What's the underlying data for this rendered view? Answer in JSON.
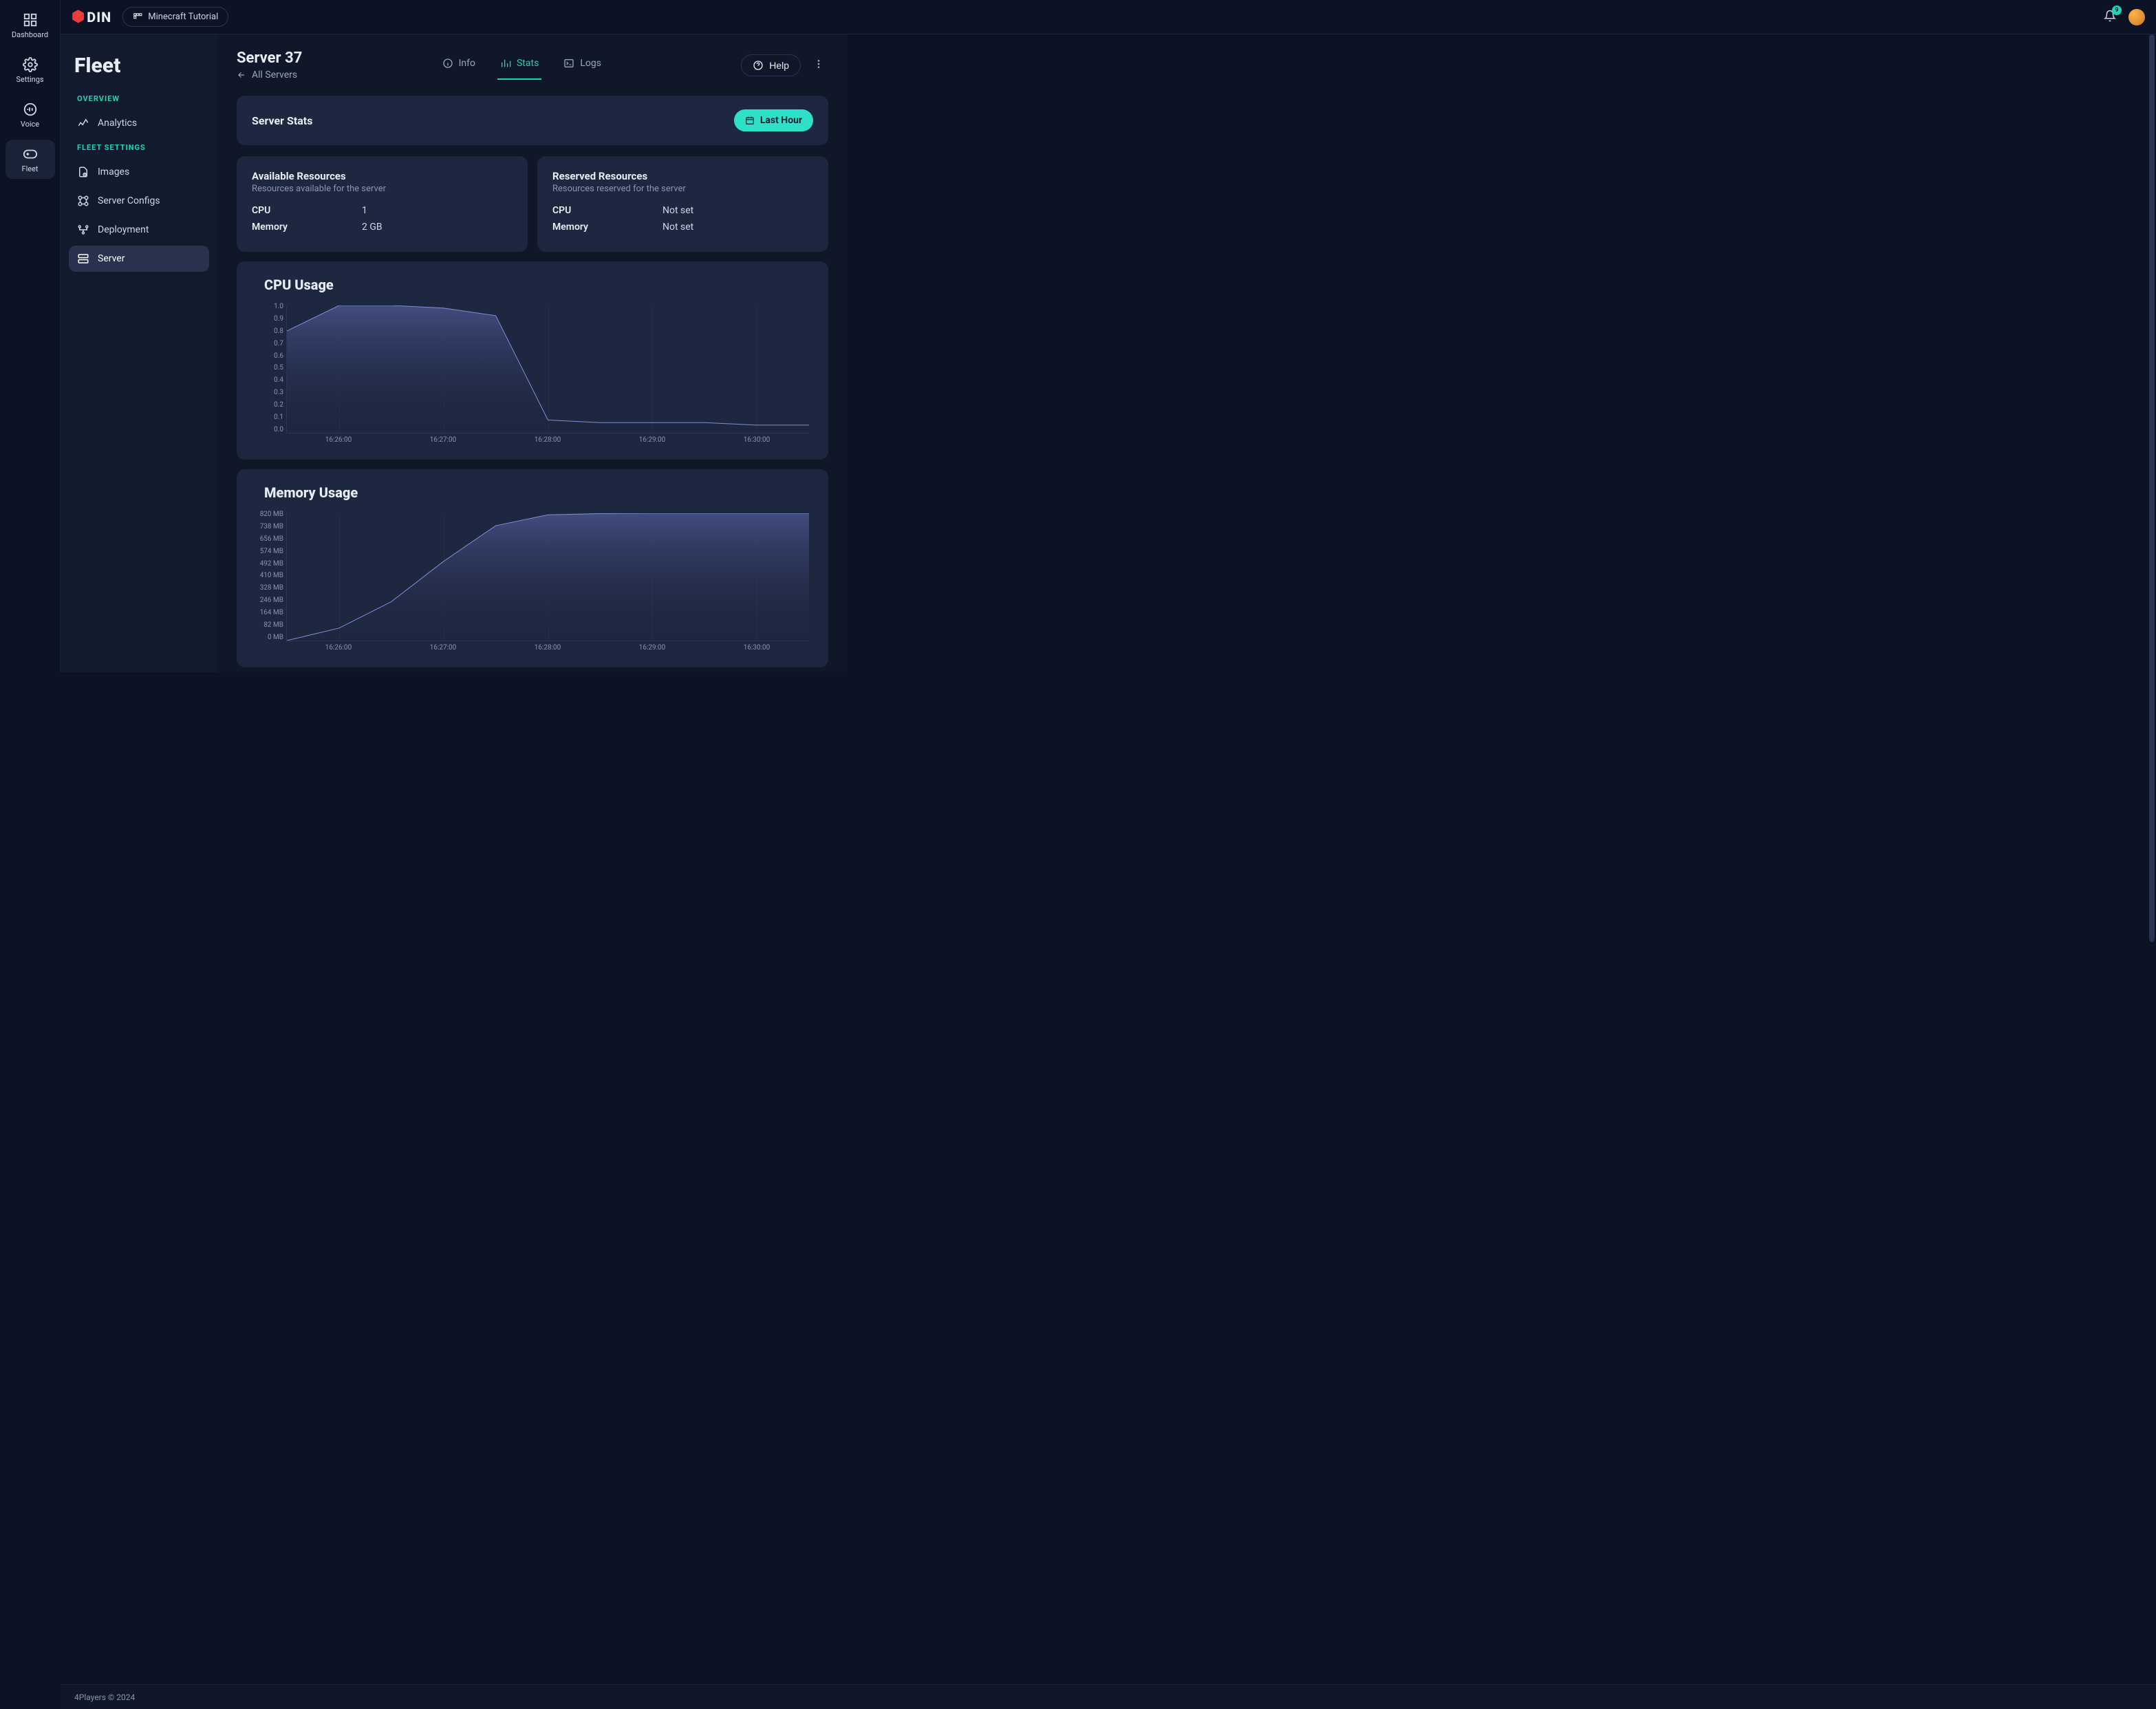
{
  "brand": {
    "name": "DIN"
  },
  "project_pill": "Minecraft Tutorial",
  "notifications_count": "9",
  "rail": [
    {
      "label": "Dashboard",
      "icon": "dashboard"
    },
    {
      "label": "Settings",
      "icon": "settings"
    },
    {
      "label": "Voice",
      "icon": "voice"
    },
    {
      "label": "Fleet",
      "icon": "fleet",
      "active": true
    }
  ],
  "sidebar": {
    "title": "Fleet",
    "sections": [
      {
        "label": "OVERVIEW",
        "items": [
          {
            "label": "Analytics",
            "icon": "analytics"
          }
        ]
      },
      {
        "label": "FLEET SETTINGS",
        "items": [
          {
            "label": "Images",
            "icon": "images"
          },
          {
            "label": "Server Configs",
            "icon": "configs"
          },
          {
            "label": "Deployment",
            "icon": "deployment"
          },
          {
            "label": "Server",
            "icon": "server",
            "active": true
          }
        ]
      }
    ]
  },
  "page": {
    "title": "Server 37",
    "back_label": "All Servers",
    "tabs": [
      {
        "label": "Info",
        "icon": "info"
      },
      {
        "label": "Stats",
        "icon": "stats",
        "active": true
      },
      {
        "label": "Logs",
        "icon": "logs"
      }
    ],
    "help_label": "Help"
  },
  "stats_panel": {
    "title": "Server Stats",
    "time_range_label": "Last Hour"
  },
  "resources": {
    "available": {
      "title": "Available Resources",
      "subtitle": "Resources available for the server",
      "cpu_label": "CPU",
      "cpu_value": "1",
      "mem_label": "Memory",
      "mem_value": "2 GB"
    },
    "reserved": {
      "title": "Reserved Resources",
      "subtitle": "Resources reserved for the server",
      "cpu_label": "CPU",
      "cpu_value": "Not set",
      "mem_label": "Memory",
      "mem_value": "Not set"
    }
  },
  "footer": "4Players © 2024",
  "chart_data": [
    {
      "type": "area",
      "title": "CPU Usage",
      "ylim": [
        0,
        1
      ],
      "y_ticks": [
        "1.0",
        "0.9",
        "0.8",
        "0.7",
        "0.6",
        "0.5",
        "0.4",
        "0.3",
        "0.2",
        "0.1",
        "0.0"
      ],
      "x_ticks": [
        "16:26:00",
        "16:27:00",
        "16:28:00",
        "16:29:00",
        "16:30:00"
      ],
      "x": [
        "16:25:30",
        "16:26:00",
        "16:26:30",
        "16:27:00",
        "16:27:30",
        "16:28:00",
        "16:28:30",
        "16:29:00",
        "16:29:30",
        "16:30:00",
        "16:30:30"
      ],
      "values": [
        0.8,
        1.0,
        1.0,
        0.98,
        0.92,
        0.1,
        0.08,
        0.08,
        0.08,
        0.06,
        0.06
      ],
      "stroke": "#7f8fd6",
      "fill_from": "#4a568fcc",
      "fill_to": "#1e274000"
    },
    {
      "type": "area",
      "title": "Memory Usage",
      "ylim": [
        0,
        820
      ],
      "y_ticks": [
        "820 MB",
        "738 MB",
        "656 MB",
        "574 MB",
        "492 MB",
        "410 MB",
        "328 MB",
        "246 MB",
        "164 MB",
        "82 MB",
        "0 MB"
      ],
      "x_ticks": [
        "16:26:00",
        "16:27:00",
        "16:28:00",
        "16:29:00",
        "16:30:00"
      ],
      "x": [
        "16:25:30",
        "16:26:00",
        "16:26:30",
        "16:27:00",
        "16:27:30",
        "16:28:00",
        "16:28:30",
        "16:29:00",
        "16:29:30",
        "16:30:00",
        "16:30:30"
      ],
      "values": [
        0,
        80,
        250,
        510,
        740,
        810,
        818,
        820,
        820,
        820,
        820
      ],
      "stroke": "#7f8fd6",
      "fill_from": "#4a568fcc",
      "fill_to": "#1e274000"
    }
  ]
}
